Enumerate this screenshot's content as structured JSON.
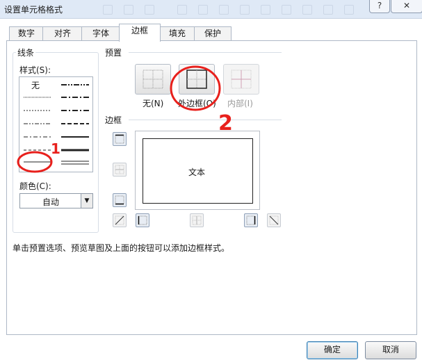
{
  "window": {
    "title": "设置单元格格式",
    "help_label": "?",
    "close_label": "✕"
  },
  "tabs": [
    {
      "label": "数字"
    },
    {
      "label": "对齐"
    },
    {
      "label": "字体"
    },
    {
      "label": "边框",
      "active": true
    },
    {
      "label": "填充"
    },
    {
      "label": "保护"
    }
  ],
  "line": {
    "group_title": "线条",
    "style_label": "样式(S):",
    "style_none": "无",
    "styles": [
      "none",
      "hairline",
      "dotted",
      "dash-dot-dot",
      "dash-dot",
      "dashed",
      "thin",
      "medium-dash-dot-dot",
      "medium-dash-dot",
      "medium-dashed",
      "medium",
      "thick",
      "double"
    ],
    "color_label": "颜色(C):",
    "color_value": "自动"
  },
  "preset": {
    "title": "预置",
    "buttons": [
      {
        "label": "无(N)",
        "icon": "preset-none-icon"
      },
      {
        "label": "外边框(O)",
        "icon": "preset-outline-icon"
      },
      {
        "label": "内部(I)",
        "icon": "preset-inside-icon",
        "disabled": true
      }
    ]
  },
  "border": {
    "title": "边框",
    "preview_text": "文本",
    "buttons": [
      "border-top-icon",
      "border-inside-horizontal-icon",
      "border-bottom-icon",
      "border-diagonal-up-icon",
      "border-left-icon",
      "border-inside-vertical-icon",
      "border-right-icon",
      "border-diagonal-down-icon"
    ]
  },
  "hint": "单击预置选项、预览草图及上面的按钮可以添加边框样式。",
  "footer": {
    "ok_label": "确定",
    "cancel_label": "取消"
  },
  "annotations": {
    "mark1": "1",
    "mark2": "2",
    "color": "#e8201c"
  },
  "colors": {
    "titlebar": "#dfe9f6",
    "accent": "#3c7fb1"
  }
}
